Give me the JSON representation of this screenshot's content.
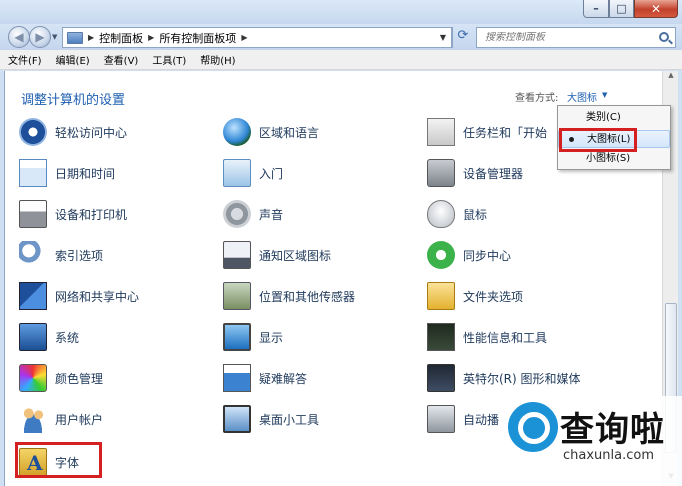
{
  "window": {
    "buttons": {
      "minimize": "–",
      "maximize": "□",
      "close": "✕"
    }
  },
  "address": {
    "crumbs": [
      "控制面板",
      "所有控制面板项"
    ],
    "search_placeholder": "搜索控制面板"
  },
  "menu": [
    "文件(F)",
    "编辑(E)",
    "查看(V)",
    "工具(T)",
    "帮助(H)"
  ],
  "header": {
    "title": "调整计算机的设置",
    "view_by_label": "查看方式:",
    "view_by_value": "大图标"
  },
  "items": [
    {
      "label": "轻松访问中心",
      "icon": "ease-of-access-icon"
    },
    {
      "label": "区域和语言",
      "icon": "globe-icon"
    },
    {
      "label": "任务栏和「开始",
      "icon": "taskbar-icon"
    },
    {
      "label": "日期和时间",
      "icon": "calendar-icon"
    },
    {
      "label": "入门",
      "icon": "getting-started-icon"
    },
    {
      "label": "设备管理器",
      "icon": "device-manager-icon"
    },
    {
      "label": "设备和打印机",
      "icon": "printer-icon"
    },
    {
      "label": "声音",
      "icon": "speaker-icon"
    },
    {
      "label": "鼠标",
      "icon": "mouse-icon"
    },
    {
      "label": "索引选项",
      "icon": "indexing-icon"
    },
    {
      "label": "通知区域图标",
      "icon": "notification-icon"
    },
    {
      "label": "同步中心",
      "icon": "sync-icon"
    },
    {
      "label": "网络和共享中心",
      "icon": "network-icon"
    },
    {
      "label": "位置和其他传感器",
      "icon": "location-sensor-icon"
    },
    {
      "label": "文件夹选项",
      "icon": "folder-icon"
    },
    {
      "label": "系统",
      "icon": "system-icon"
    },
    {
      "label": "显示",
      "icon": "display-icon"
    },
    {
      "label": "性能信息和工具",
      "icon": "performance-icon"
    },
    {
      "label": "颜色管理",
      "icon": "color-management-icon"
    },
    {
      "label": "疑难解答",
      "icon": "troubleshooting-icon"
    },
    {
      "label": "英特尔(R) 图形和媒体",
      "icon": "intel-graphics-icon"
    },
    {
      "label": "用户帐户",
      "icon": "user-accounts-icon"
    },
    {
      "label": "桌面小工具",
      "icon": "gadgets-icon"
    },
    {
      "label": "自动播",
      "icon": "autoplay-icon"
    },
    {
      "label": "字体",
      "icon": "font-icon"
    }
  ],
  "dropdown": {
    "options": [
      "类别(C)",
      "大图标(L)",
      "小图标(S)"
    ],
    "selected": "大图标(L)"
  },
  "watermark": {
    "title": "查询啦",
    "url": "chaxunla.com"
  }
}
